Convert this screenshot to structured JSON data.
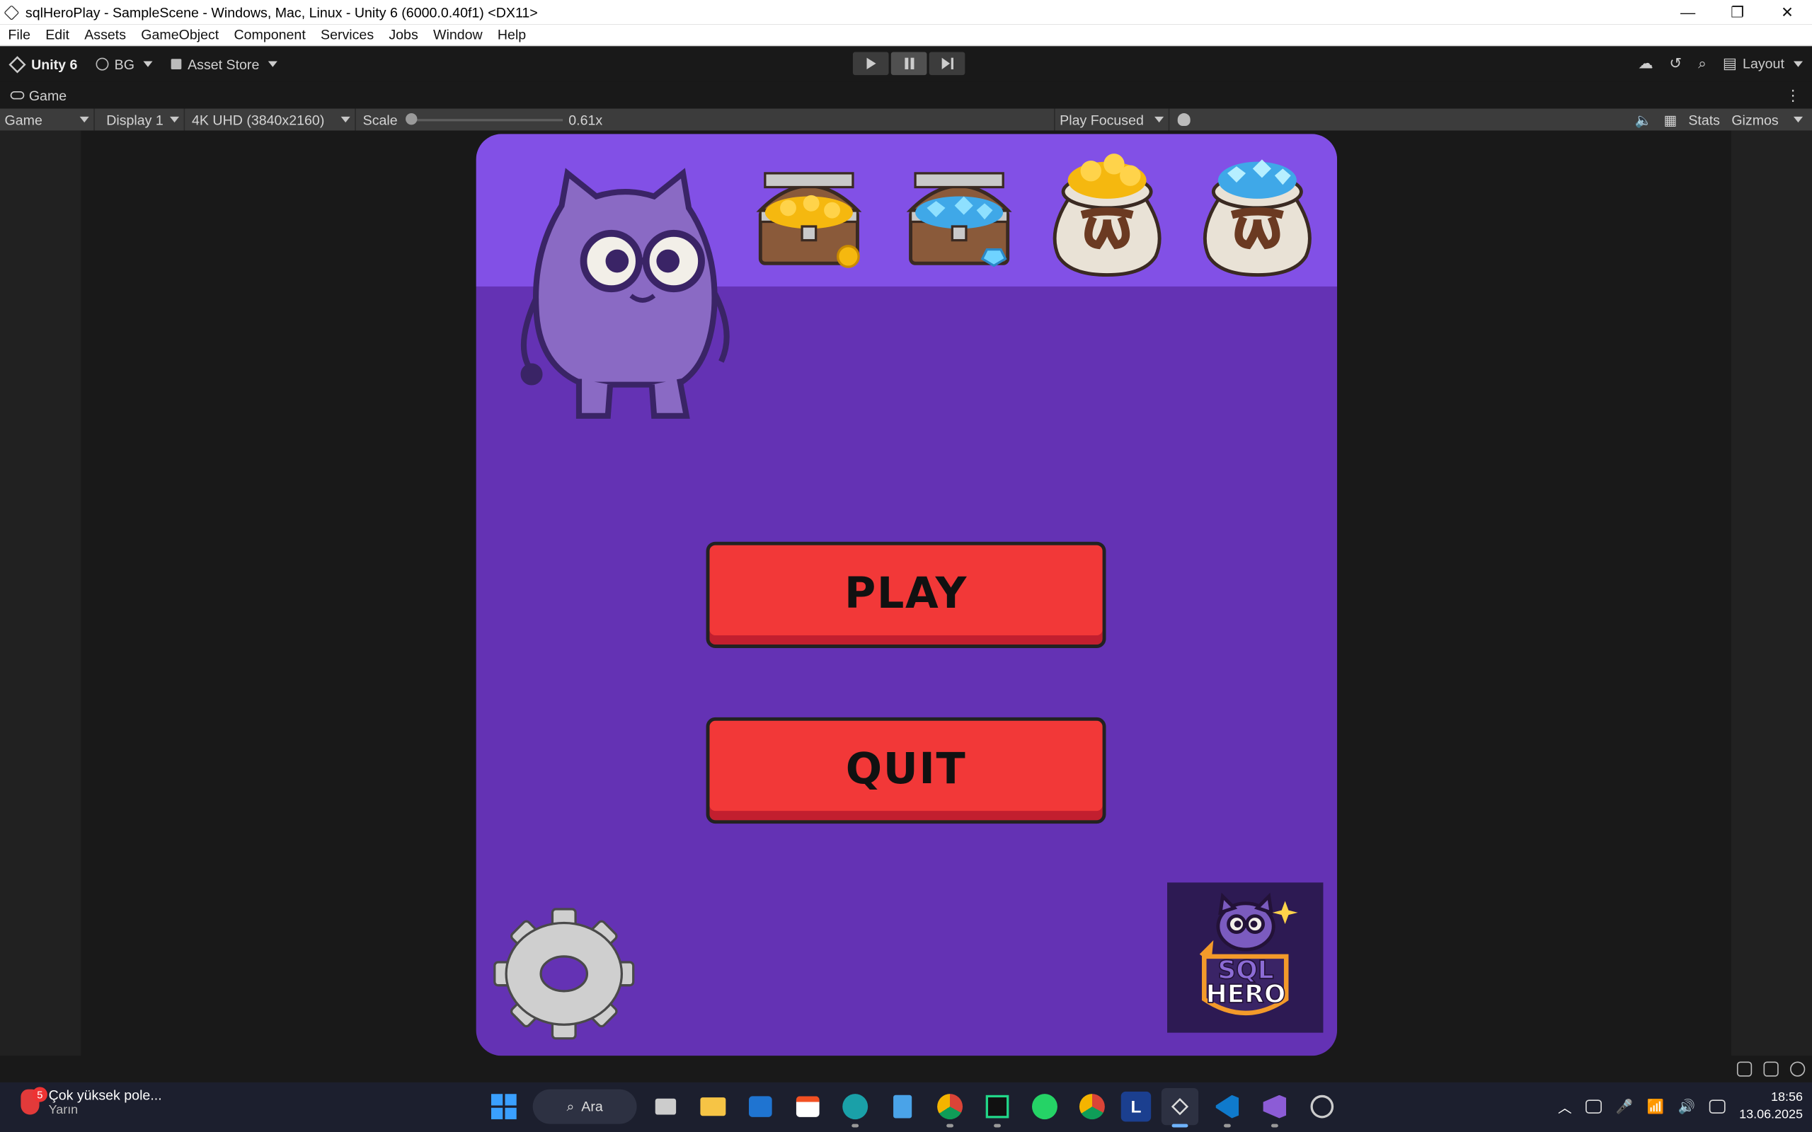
{
  "window": {
    "title": "sqlHeroPlay - SampleScene - Windows, Mac, Linux - Unity 6 (6000.0.40f1) <DX11>",
    "minimize_glyph": "—",
    "restore_glyph": "❐",
    "close_glyph": "✕"
  },
  "menu": [
    "File",
    "Edit",
    "Assets",
    "GameObject",
    "Component",
    "Services",
    "Jobs",
    "Window",
    "Help"
  ],
  "toolbar": {
    "unity_label": "Unity 6",
    "account_label": "BG",
    "asset_store_label": "Asset Store",
    "layout_label": "Layout"
  },
  "game_tab": {
    "label": "Game"
  },
  "game_controls": {
    "view_select": "Game",
    "display_select": "Display 1",
    "resolution_select": "4K UHD (3840x2160)",
    "scale_label": "Scale",
    "scale_value": "0.61x",
    "scale_fraction": 0.02,
    "play_mode_select": "Play Focused",
    "stats_label": "Stats",
    "gizmos_label": "Gizmos"
  },
  "game": {
    "play_label": "PLAY",
    "quit_label": "QUIT",
    "logo_line1": "SQL",
    "logo_line2": "HERO"
  },
  "taskbar": {
    "weather_badge": "5",
    "weather_title": "Çok yüksek pole...",
    "weather_sub": "Yarın",
    "search_label": "Ara",
    "time": "18:56",
    "date": "13.06.2025"
  }
}
